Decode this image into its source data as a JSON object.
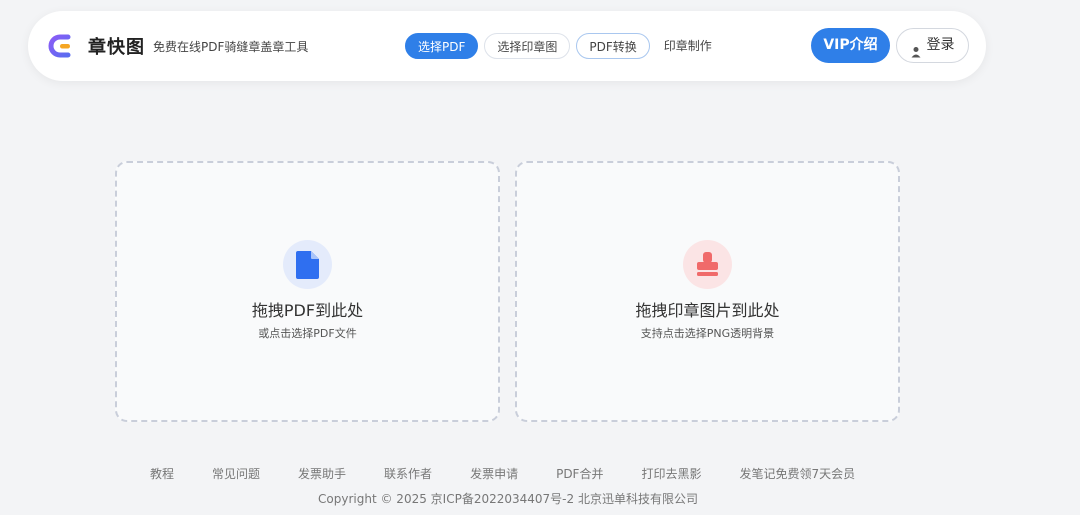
{
  "header": {
    "brand": "章快图",
    "slogan": "免费在线PDF骑缝章盖章工具",
    "logo_icon": "brand-logo-icon",
    "steps": [
      {
        "label": "选择PDF",
        "state": "active"
      },
      {
        "label": "选择印章图",
        "state": "normal"
      },
      {
        "label": "PDF转换",
        "state": "normal"
      },
      {
        "label": "印章制作",
        "state": "plain"
      }
    ],
    "vip_label": "VIP介绍",
    "login_label": "登录"
  },
  "upload": {
    "pdf": {
      "icon": "file-icon",
      "title": "拖拽PDF到此处",
      "subtitle": "或点击选择PDF文件"
    },
    "stamp": {
      "icon": "stamp-icon",
      "title": "拖拽印章图片到此处",
      "subtitle": "支持点击选择PNG透明背景"
    }
  },
  "footer": {
    "links": [
      "教程",
      "常见问题",
      "发票助手",
      "联系作者",
      "发票申请",
      "PDF合并",
      "打印去黑影",
      "发笔记免费领7天会员"
    ],
    "copyright": "Copyright © 2025 京ICP备2022034407号-2 北京迅单科技有限公司"
  },
  "colors": {
    "accent": "#2f7fe8",
    "file_icon": "#2f6ff0",
    "stamp_icon": "#f06a6a",
    "background": "#f3f4f6"
  }
}
